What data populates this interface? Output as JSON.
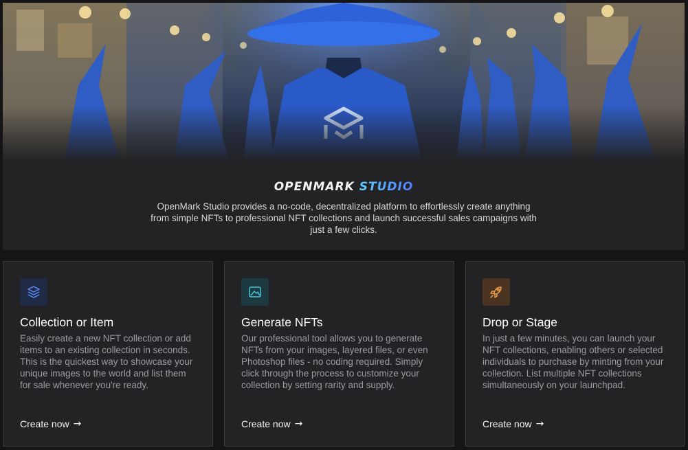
{
  "hero": {
    "illustration": "blue-robed-wizards-in-market-street",
    "emblem_icon": "openmark-logo-icon"
  },
  "intro": {
    "brand_part1": "OPENMARK",
    "brand_part2": "STUDIO",
    "description": "OpenMark Studio provides a no-code, decentralized platform to effortlessly create anything from simple NFTs to professional NFT collections and launch successful sales campaigns with just a few clicks."
  },
  "cards": [
    {
      "icon": "layers-icon",
      "icon_color": "#5b8cff",
      "icon_bg": "#1f2a44",
      "title": "Collection or Item",
      "body": "Easily create a new NFT collection or add items to an existing collection in seconds. This is the quickest way to showcase your unique images to the world and list them for sale whenever you're ready.",
      "cta": "Create now",
      "arrow": "→"
    },
    {
      "icon": "image-icon",
      "icon_color": "#4fc3d9",
      "icon_bg": "#1d3a40",
      "title": "Generate NFTs",
      "body": "Our professional tool allows you to generate NFTs from your images, layered files, or even Photoshop files - no coding required. Simply click through the process to customize your collection by setting rarity and supply.",
      "cta": "Create now",
      "arrow": "→"
    },
    {
      "icon": "rocket-icon",
      "icon_color": "#f0a04a",
      "icon_bg": "#4a3320",
      "title": "Drop or Stage",
      "body": "In just a few minutes, you can launch your NFT collections, enabling others or selected individuals to purchase by minting from your collection. List multiple NFT collections simultaneously on your launchpad.",
      "cta": "Create now",
      "arrow": "→"
    }
  ]
}
